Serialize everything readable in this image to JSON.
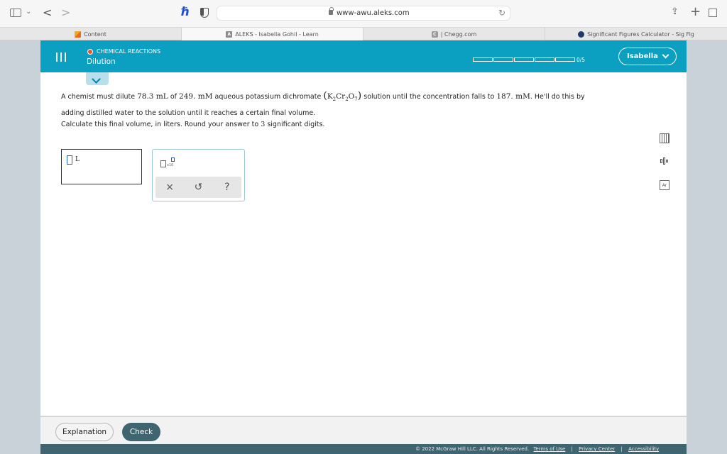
{
  "browser": {
    "url": "www-awu.aleks.com",
    "tabs": [
      {
        "label": "Content",
        "favicon": "content-favicon"
      },
      {
        "label": "ALEKS - Isabella Gohil - Learn",
        "favicon": "aleks-favicon",
        "favicon_text": "A"
      },
      {
        "label": "| Chegg.com",
        "favicon": "chegg-favicon",
        "favicon_text": "C"
      },
      {
        "label": "Significant Figures Calculator - Sig Fig",
        "favicon": "sigfig-favicon"
      }
    ]
  },
  "header": {
    "category": "CHEMICAL REACTIONS",
    "topic": "Dilution",
    "progress_label": "0/5",
    "progress_segments": 5,
    "progress_filled": 0,
    "user_name": "Isabella",
    "accent_color": "#0b9fc1"
  },
  "question": {
    "p1": "A chemist must dilute",
    "v1": "78.3",
    "u1": "mL",
    "p2": "of",
    "c1": "249.",
    "cu1": "mM",
    "p3": "aqueous potassium dichromate",
    "formula_k": "K",
    "formula_k_sub": "2",
    "formula_cr": "Cr",
    "formula_cr_sub": "2",
    "formula_o": "O",
    "formula_o_sub": "7",
    "p4": "solution until the concentration falls to",
    "c2": "187.",
    "cu2": "mM",
    "p5": ". He'll do this by",
    "p6": "adding distilled water to the solution until it reaches a certain final volume.",
    "instruction_pre": "Calculate this final volume, in liters. Round your answer to",
    "sig_figs": "3",
    "instruction_post": "significant digits."
  },
  "answer": {
    "value": "",
    "unit": "L"
  },
  "tool_palette": {
    "sci_notation_label": "x10",
    "clear": "×",
    "undo": "↺",
    "help": "?"
  },
  "footer": {
    "explanation_label": "Explanation",
    "check_label": "Check",
    "copyright": "© 2022 McGraw Hill LLC. All Rights Reserved.",
    "terms": "Terms of Use",
    "privacy": "Privacy Center",
    "accessibility": "Accessibility"
  }
}
